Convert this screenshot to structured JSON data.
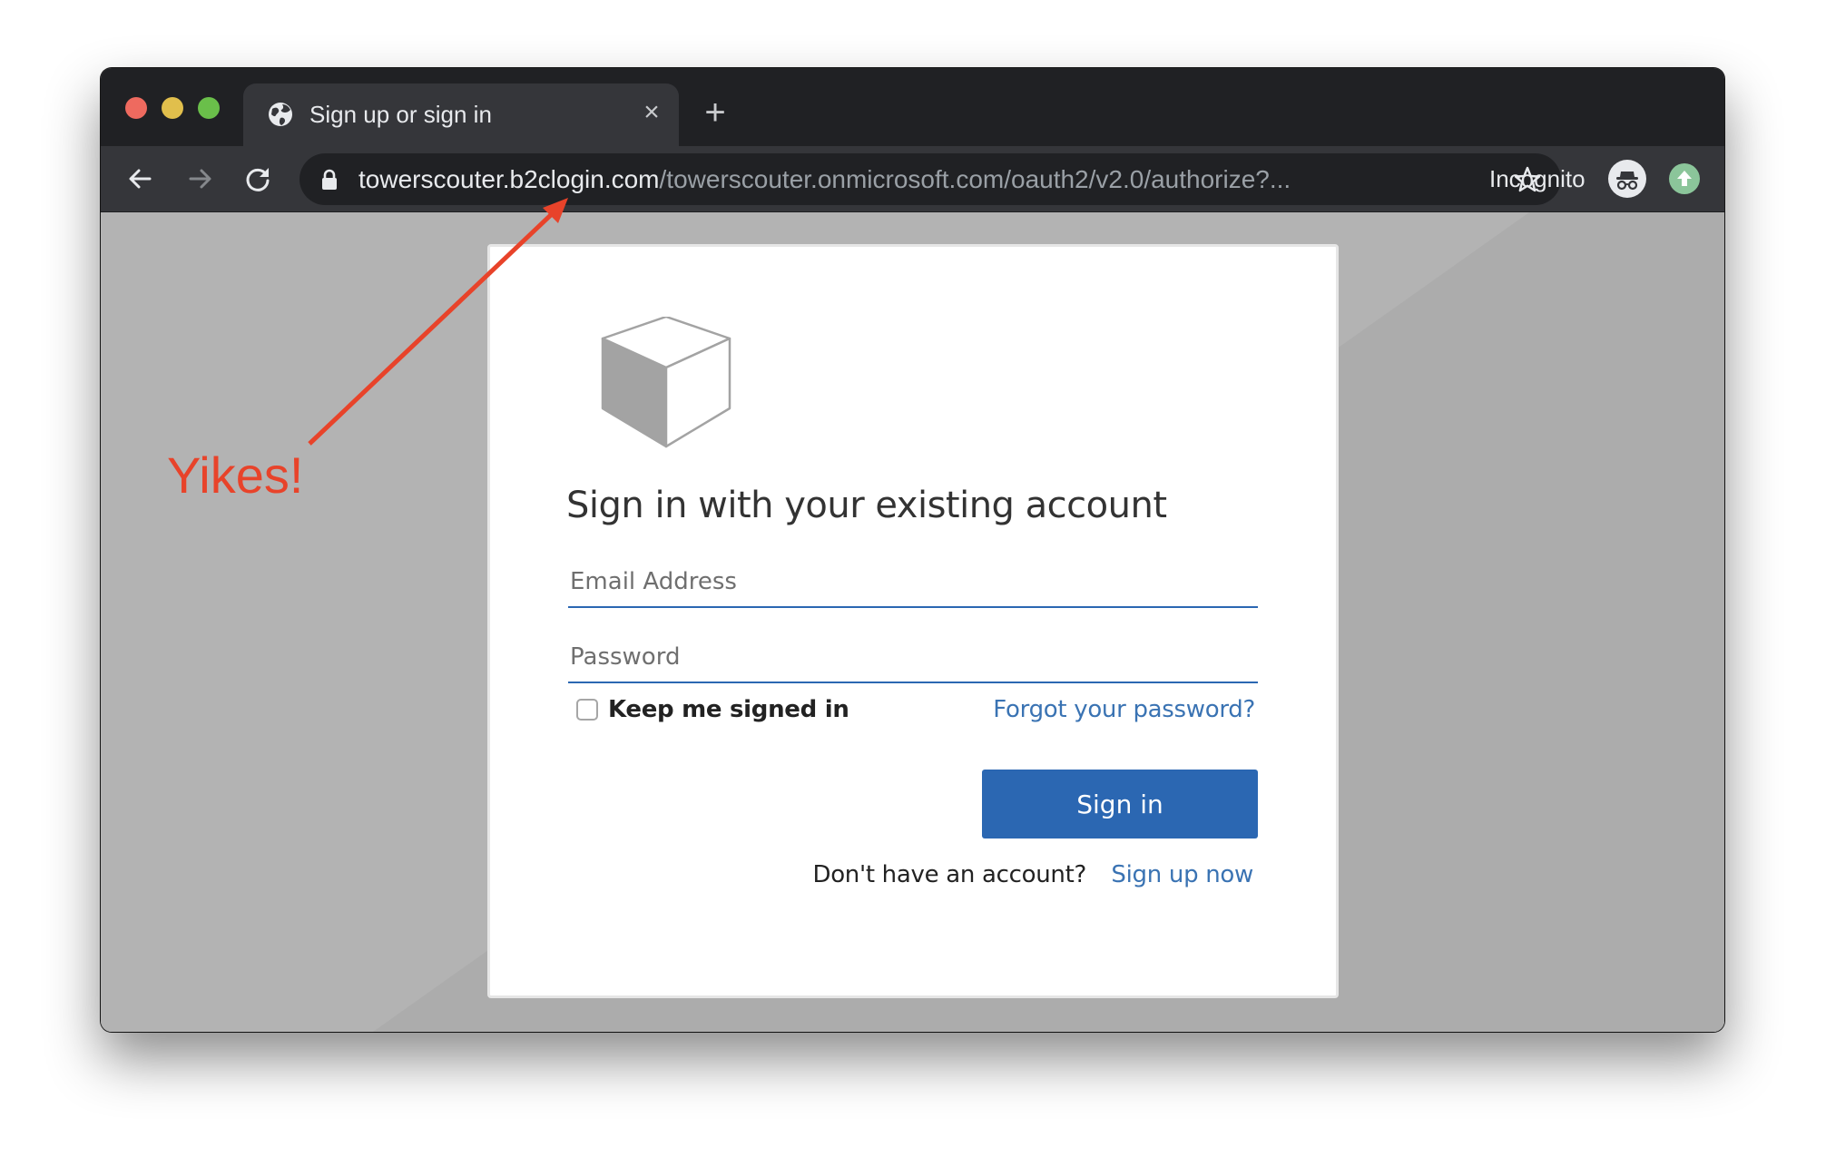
{
  "window": {
    "controls": {
      "close_color": "#ee6a5f",
      "minimize_color": "#e1bf4c",
      "zoom_color": "#6abf4a"
    }
  },
  "tabs": [
    {
      "title": "Sign up or sign in",
      "icon": "globe-icon",
      "close_icon": "×",
      "active": true
    }
  ],
  "new_tab_icon": "+",
  "toolbar": {
    "back_icon": "arrow-left-icon",
    "forward_icon": "arrow-right-icon",
    "reload_icon": "reload-icon",
    "url_host": "towerscouter.b2clogin.com",
    "url_path": "/towerscouter.onmicrosoft.com/oauth2/v2.0/authorize?...",
    "secure": true,
    "bookmark_icon": "star-icon",
    "profile_label": "Incognito",
    "update_icon": "update-arrow-icon"
  },
  "page": {
    "logo": "cube-logo",
    "heading": "Sign in with your existing account",
    "email": {
      "placeholder": "Email Address",
      "value": ""
    },
    "password": {
      "placeholder": "Password",
      "value": ""
    },
    "remember_me": {
      "label": "Keep me signed in",
      "checked": false
    },
    "forgot_link": "Forgot your password?",
    "signin_button": "Sign in",
    "no_account_text": "Don't have an account?",
    "signup_link": "Sign up now"
  },
  "annotation": {
    "label": "Yikes!",
    "color": "#e8432a",
    "points_to": "url_host"
  },
  "colors": {
    "primary": "#2b67b2",
    "link": "#3a73b3",
    "titlebar": "#202124",
    "toolbar": "#35363a"
  }
}
